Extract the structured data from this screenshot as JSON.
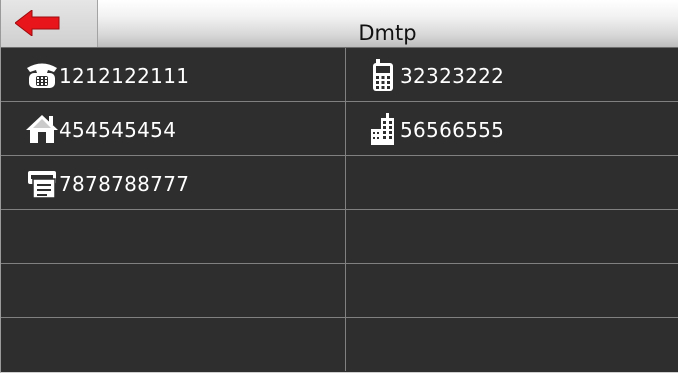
{
  "header": {
    "title": "Dmtp",
    "back_icon": "back-arrow-icon",
    "back_color": "#e8161b"
  },
  "numbers": [
    {
      "icon": "telephone-icon",
      "value": "1212122111"
    },
    {
      "icon": "mobile-phone-icon",
      "value": "32323222"
    },
    {
      "icon": "home-icon",
      "value": "454545454"
    },
    {
      "icon": "office-building-icon",
      "value": "56566555"
    },
    {
      "icon": "fax-icon",
      "value": "7878788777"
    }
  ],
  "colors": {
    "background": "#2e2e2e",
    "text": "#ffffff",
    "divider": "#808080"
  }
}
